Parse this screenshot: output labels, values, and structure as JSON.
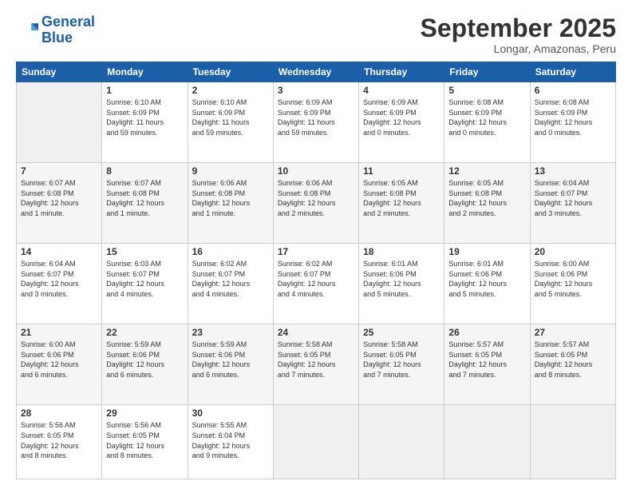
{
  "logo": {
    "line1": "General",
    "line2": "Blue"
  },
  "title": "September 2025",
  "subtitle": "Longar, Amazonas, Peru",
  "headers": [
    "Sunday",
    "Monday",
    "Tuesday",
    "Wednesday",
    "Thursday",
    "Friday",
    "Saturday"
  ],
  "weeks": [
    [
      {
        "day": "",
        "info": ""
      },
      {
        "day": "1",
        "info": "Sunrise: 6:10 AM\nSunset: 6:09 PM\nDaylight: 11 hours\nand 59 minutes."
      },
      {
        "day": "2",
        "info": "Sunrise: 6:10 AM\nSunset: 6:09 PM\nDaylight: 11 hours\nand 59 minutes."
      },
      {
        "day": "3",
        "info": "Sunrise: 6:09 AM\nSunset: 6:09 PM\nDaylight: 11 hours\nand 59 minutes."
      },
      {
        "day": "4",
        "info": "Sunrise: 6:09 AM\nSunset: 6:09 PM\nDaylight: 12 hours\nand 0 minutes."
      },
      {
        "day": "5",
        "info": "Sunrise: 6:08 AM\nSunset: 6:09 PM\nDaylight: 12 hours\nand 0 minutes."
      },
      {
        "day": "6",
        "info": "Sunrise: 6:08 AM\nSunset: 6:09 PM\nDaylight: 12 hours\nand 0 minutes."
      }
    ],
    [
      {
        "day": "7",
        "info": "Sunrise: 6:07 AM\nSunset: 6:08 PM\nDaylight: 12 hours\nand 1 minute."
      },
      {
        "day": "8",
        "info": "Sunrise: 6:07 AM\nSunset: 6:08 PM\nDaylight: 12 hours\nand 1 minute."
      },
      {
        "day": "9",
        "info": "Sunrise: 6:06 AM\nSunset: 6:08 PM\nDaylight: 12 hours\nand 1 minute."
      },
      {
        "day": "10",
        "info": "Sunrise: 6:06 AM\nSunset: 6:08 PM\nDaylight: 12 hours\nand 2 minutes."
      },
      {
        "day": "11",
        "info": "Sunrise: 6:05 AM\nSunset: 6:08 PM\nDaylight: 12 hours\nand 2 minutes."
      },
      {
        "day": "12",
        "info": "Sunrise: 6:05 AM\nSunset: 6:08 PM\nDaylight: 12 hours\nand 2 minutes."
      },
      {
        "day": "13",
        "info": "Sunrise: 6:04 AM\nSunset: 6:07 PM\nDaylight: 12 hours\nand 3 minutes."
      }
    ],
    [
      {
        "day": "14",
        "info": "Sunrise: 6:04 AM\nSunset: 6:07 PM\nDaylight: 12 hours\nand 3 minutes."
      },
      {
        "day": "15",
        "info": "Sunrise: 6:03 AM\nSunset: 6:07 PM\nDaylight: 12 hours\nand 4 minutes."
      },
      {
        "day": "16",
        "info": "Sunrise: 6:02 AM\nSunset: 6:07 PM\nDaylight: 12 hours\nand 4 minutes."
      },
      {
        "day": "17",
        "info": "Sunrise: 6:02 AM\nSunset: 6:07 PM\nDaylight: 12 hours\nand 4 minutes."
      },
      {
        "day": "18",
        "info": "Sunrise: 6:01 AM\nSunset: 6:06 PM\nDaylight: 12 hours\nand 5 minutes."
      },
      {
        "day": "19",
        "info": "Sunrise: 6:01 AM\nSunset: 6:06 PM\nDaylight: 12 hours\nand 5 minutes."
      },
      {
        "day": "20",
        "info": "Sunrise: 6:00 AM\nSunset: 6:06 PM\nDaylight: 12 hours\nand 5 minutes."
      }
    ],
    [
      {
        "day": "21",
        "info": "Sunrise: 6:00 AM\nSunset: 6:06 PM\nDaylight: 12 hours\nand 6 minutes."
      },
      {
        "day": "22",
        "info": "Sunrise: 5:59 AM\nSunset: 6:06 PM\nDaylight: 12 hours\nand 6 minutes."
      },
      {
        "day": "23",
        "info": "Sunrise: 5:59 AM\nSunset: 6:06 PM\nDaylight: 12 hours\nand 6 minutes."
      },
      {
        "day": "24",
        "info": "Sunrise: 5:58 AM\nSunset: 6:05 PM\nDaylight: 12 hours\nand 7 minutes."
      },
      {
        "day": "25",
        "info": "Sunrise: 5:58 AM\nSunset: 6:05 PM\nDaylight: 12 hours\nand 7 minutes."
      },
      {
        "day": "26",
        "info": "Sunrise: 5:57 AM\nSunset: 6:05 PM\nDaylight: 12 hours\nand 7 minutes."
      },
      {
        "day": "27",
        "info": "Sunrise: 5:57 AM\nSunset: 6:05 PM\nDaylight: 12 hours\nand 8 minutes."
      }
    ],
    [
      {
        "day": "28",
        "info": "Sunrise: 5:56 AM\nSunset: 6:05 PM\nDaylight: 12 hours\nand 8 minutes."
      },
      {
        "day": "29",
        "info": "Sunrise: 5:56 AM\nSunset: 6:05 PM\nDaylight: 12 hours\nand 8 minutes."
      },
      {
        "day": "30",
        "info": "Sunrise: 5:55 AM\nSunset: 6:04 PM\nDaylight: 12 hours\nand 9 minutes."
      },
      {
        "day": "",
        "info": ""
      },
      {
        "day": "",
        "info": ""
      },
      {
        "day": "",
        "info": ""
      },
      {
        "day": "",
        "info": ""
      }
    ]
  ]
}
